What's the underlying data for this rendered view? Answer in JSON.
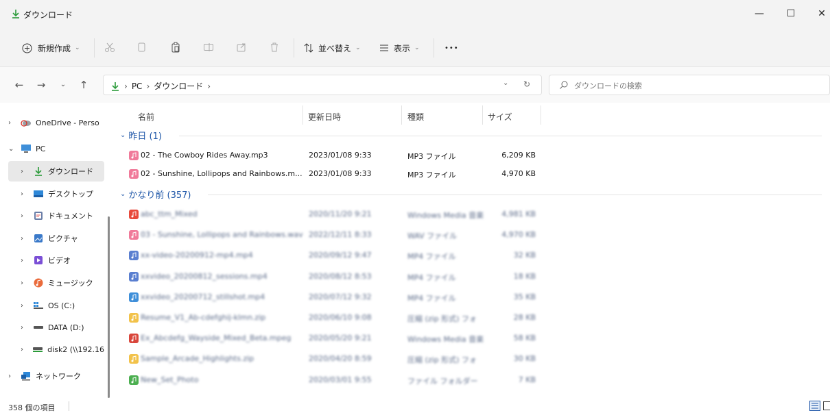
{
  "window": {
    "title": "ダウンロード",
    "minimize_glyph": "—",
    "maximize_glyph": "☐",
    "close_glyph": "✕"
  },
  "toolbar": {
    "new_label": "新規作成",
    "sort_label": "並べ替え",
    "view_label": "表示",
    "more_label": "•••",
    "icons": [
      "cut-icon",
      "copy-icon",
      "paste-icon",
      "rename-icon",
      "share-icon",
      "delete-icon"
    ]
  },
  "address": {
    "crumbs": [
      "PC",
      "ダウンロード"
    ],
    "search_placeholder": "ダウンロードの検索"
  },
  "sidebar": {
    "items": [
      {
        "label": "OneDrive - Perso",
        "icon": "onedrive-icon",
        "expanded": false
      },
      {
        "label": "PC",
        "icon": "pc-icon",
        "expanded": true
      },
      {
        "label": "ダウンロード",
        "icon": "download-icon",
        "expanded": false,
        "selected": true
      },
      {
        "label": "デスクトップ",
        "icon": "desktop-icon",
        "expanded": false
      },
      {
        "label": "ドキュメント",
        "icon": "documents-icon",
        "expanded": false
      },
      {
        "label": "ピクチャ",
        "icon": "pictures-icon",
        "expanded": false
      },
      {
        "label": "ビデオ",
        "icon": "videos-icon",
        "expanded": false
      },
      {
        "label": "ミュージック",
        "icon": "music-icon",
        "expanded": false
      },
      {
        "label": "OS (C:)",
        "icon": "drive-c-icon",
        "expanded": false
      },
      {
        "label": "DATA (D:)",
        "icon": "drive-d-icon",
        "expanded": false
      },
      {
        "label": "disk2 (\\\\192.16",
        "icon": "network-drive-icon",
        "expanded": false
      },
      {
        "label": "ネットワーク",
        "icon": "network-icon",
        "expanded": false
      }
    ]
  },
  "filelist": {
    "columns": {
      "name": "名前",
      "date": "更新日時",
      "type": "種類",
      "size": "サイズ"
    },
    "groups": [
      {
        "label": "昨日 (1)"
      },
      {
        "label": "かなり前 (357)"
      }
    ],
    "rows": [
      {
        "name": "02 - The Cowboy Rides Away.mp3",
        "date": "2023/01/08 9:33",
        "type": "MP3 ファイル",
        "size": "6,209 KB",
        "icon_color": "#f07a9a",
        "blurred": false
      },
      {
        "name": "02 - Sunshine, Lollipops and Rainbows.m...",
        "date": "2023/01/08 9:33",
        "type": "MP3 ファイル",
        "size": "4,970 KB",
        "icon_color": "#f07a9a",
        "blurred": false
      },
      {
        "name": "abc_ttm_Mixed",
        "date": "2020/11/20 9:21",
        "type": "Windows Media 音楽",
        "size": "4,981 KB",
        "icon_color": "#e84a3c",
        "blurred": true
      },
      {
        "name": "03 - Sunshine, Lollipops and Rainbows.wav",
        "date": "2022/12/11 8:33",
        "type": "WAV ファイル",
        "size": "4,970 KB",
        "icon_color": "#f07a9a",
        "blurred": true
      },
      {
        "name": "xx-video-20200912-mp4.mp4",
        "date": "2020/09/12 9:47",
        "type": "MP4 ファイル",
        "size": "32 KB",
        "icon_color": "#5a7fd0",
        "blurred": true
      },
      {
        "name": "xxvideo_20200812_sessions.mp4",
        "date": "2020/08/12 8:53",
        "type": "MP4 ファイル",
        "size": "18 KB",
        "icon_color": "#5a7fd0",
        "blurred": true
      },
      {
        "name": "xxvideo_20200712_stillshot.mp4",
        "date": "2020/07/12 9:32",
        "type": "MP4 ファイル",
        "size": "35 KB",
        "icon_color": "#3f8fd9",
        "blurred": true
      },
      {
        "name": "Resume_V1_Ab-cdefghij-klmn.zip",
        "date": "2020/06/10 9:08",
        "type": "圧縮 (zip 形式) フォ",
        "size": "28 KB",
        "icon_color": "#f2c24a",
        "blurred": true
      },
      {
        "name": "Ex_Abcdefg_Wayside_Mixed_Beta.mpeg",
        "date": "2020/05/20 9:21",
        "type": "Windows Media 音楽",
        "size": "58 KB",
        "icon_color": "#d9463b",
        "blurred": true
      },
      {
        "name": "Sample_Arcade_Highlights.zip",
        "date": "2020/04/20 8:59",
        "type": "圧縮 (zip 形式) フォ",
        "size": "30 KB",
        "icon_color": "#f2c24a",
        "blurred": true
      },
      {
        "name": "New_Set_Photo",
        "date": "2020/03/01 9:55",
        "type": "ファイル フォルダー",
        "size": "7 KB",
        "icon_color": "#4caf50",
        "blurred": true
      }
    ]
  },
  "status": {
    "item_count": "358 個の項目"
  },
  "colors": {
    "accent": "#1e56a8",
    "download_arrow": "#2b9b3a",
    "chrome_bg": "#f3f3f3",
    "selected_bg": "#e8e8e8"
  }
}
